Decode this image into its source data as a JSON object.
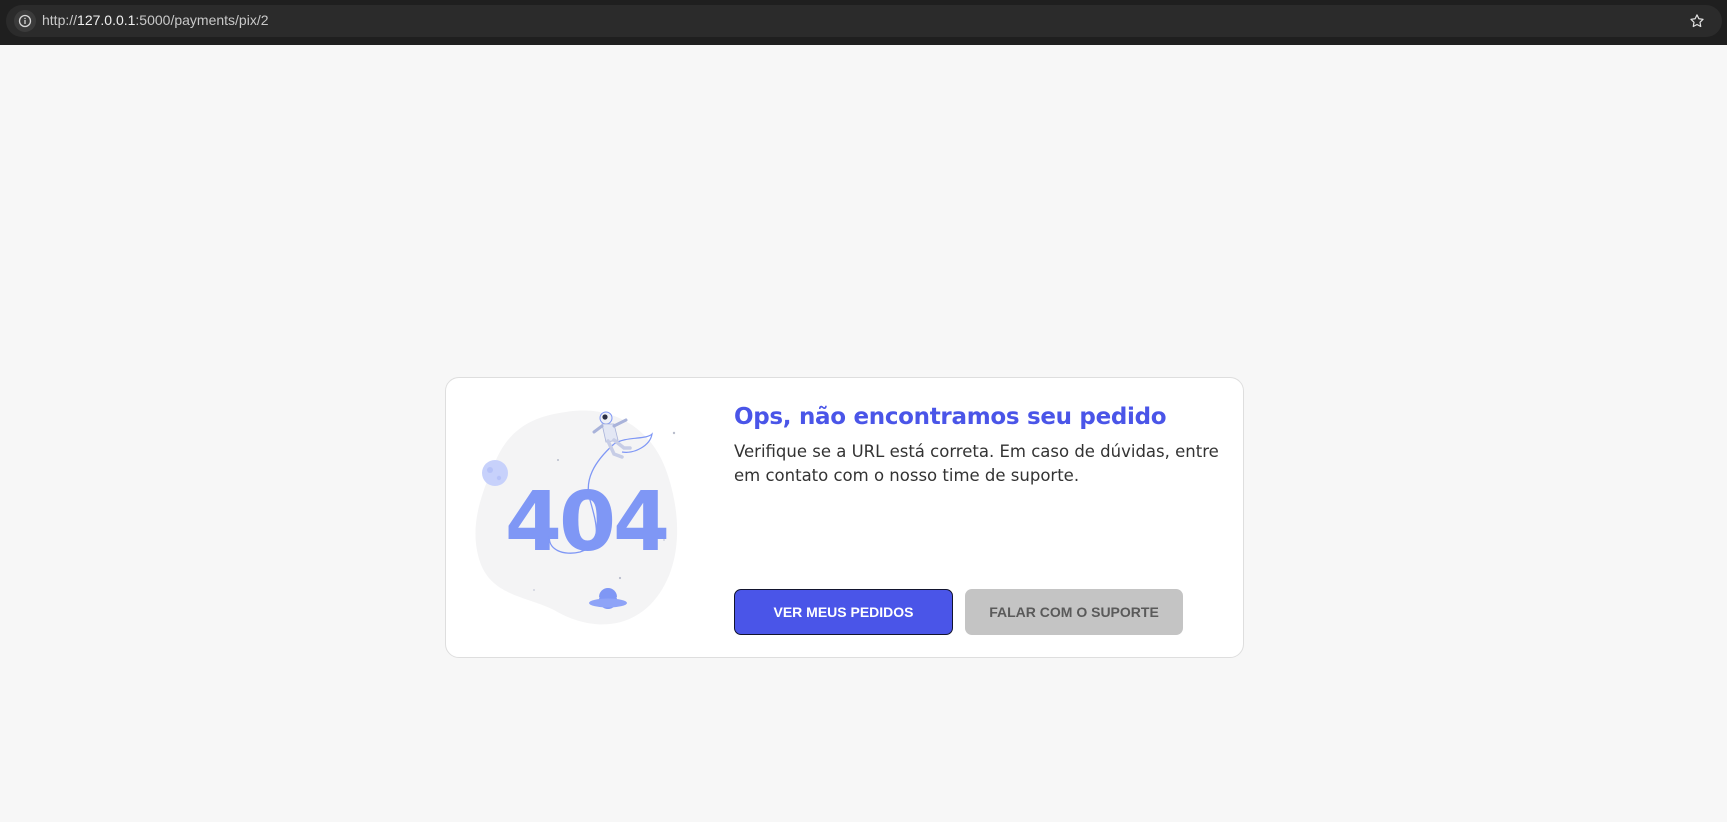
{
  "browser": {
    "url_scheme": "http://",
    "url_host": "127.0.0.1",
    "url_rest": ":5000/payments/pix/2"
  },
  "error": {
    "code": "404",
    "title": "Ops, não encontramos seu pedido",
    "description": "Verifique se a URL está correta. Em caso de dúvidas, entre em contato com o nosso time de suporte."
  },
  "actions": {
    "primary_label": "VER MEUS PEDIDOS",
    "secondary_label": "FALAR COM O SUPORTE"
  },
  "icons": {
    "site_info": "info-icon",
    "bookmark": "star-icon"
  },
  "colors": {
    "accent": "#4a55e8",
    "illustration": "#7f97f5",
    "page_background": "#f7f7f7"
  }
}
